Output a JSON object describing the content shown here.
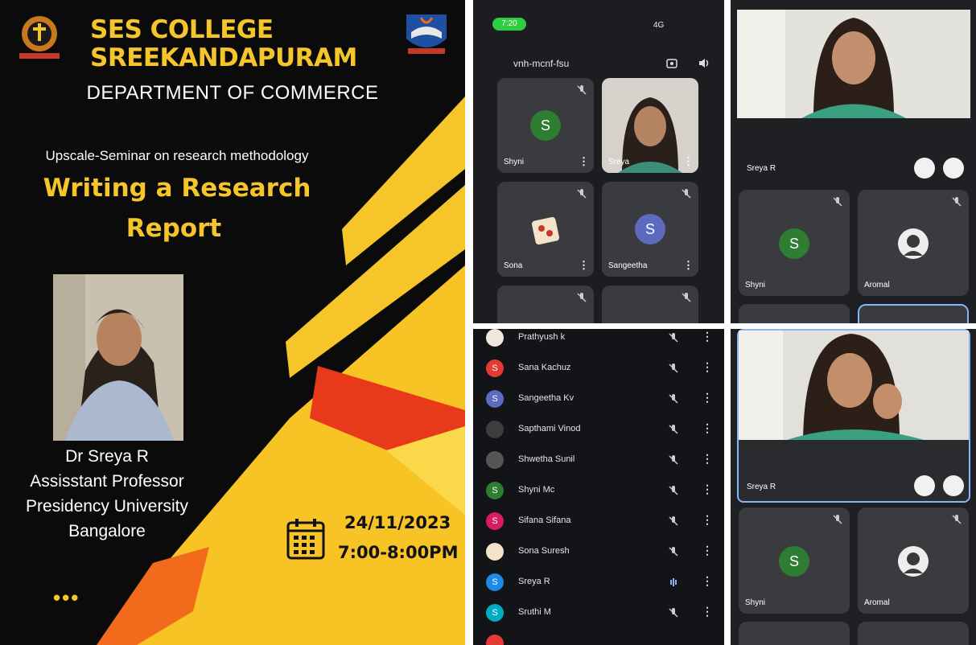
{
  "poster": {
    "college_line1": "SES COLLEGE",
    "college_line2": "SREEKANDAPURAM",
    "department": "DEPARTMENT OF COMMERCE",
    "seminar": "Upscale-Seminar on research methodology",
    "title_line1": "Writing a Research",
    "title_line2": "Report",
    "speaker_name": "Dr Sreya R",
    "speaker_role": "Assisstant Professor",
    "speaker_org": "Presidency University",
    "speaker_city": "Bangalore",
    "date": "24/11/2023",
    "time": "7:00-8:00PM",
    "more_dots": "•••",
    "icons": [
      "college-crest-icon",
      "college-emblem-icon",
      "calendar-icon"
    ],
    "colors": {
      "background": "#0b0b0b",
      "accent_yellow": "#f5c52a",
      "accent_orange": "#f26a1b"
    }
  },
  "phone_grid": {
    "status_time": "7:20",
    "status_network": "4G",
    "meeting_code": "vnh-mcnf-fsu",
    "tiles": [
      {
        "name": "Shyni",
        "initial": "S",
        "color": "#2e7d32"
      },
      {
        "name": "Sreya",
        "initial": "",
        "color": ""
      },
      {
        "name": "Sona",
        "initial": "",
        "color": ""
      },
      {
        "name": "Sangeetha",
        "initial": "S",
        "color": "#5c6bc0"
      }
    ],
    "icons": [
      "camera-switch-icon",
      "speaker-icon",
      "mic-off-icon",
      "more-vert-icon"
    ]
  },
  "speaker_view_top": {
    "main_name": "Sreya R",
    "tiles": [
      {
        "name": "Shyni",
        "initial": "S",
        "color": "#2e7d32"
      },
      {
        "name": "Aromal",
        "initial": "",
        "color": ""
      }
    ]
  },
  "participants": {
    "rows": [
      {
        "name": "Prathyush k",
        "initial": "",
        "color": "#888888"
      },
      {
        "name": "Sana Kachuz",
        "initial": "S",
        "color": "#e53935"
      },
      {
        "name": "Sangeetha Kv",
        "initial": "S",
        "color": "#5c6bc0"
      },
      {
        "name": "Sapthami Vinod",
        "initial": "",
        "color": "#444444"
      },
      {
        "name": "Shwetha Sunil",
        "initial": "",
        "color": "#555555"
      },
      {
        "name": "Shyni Mc",
        "initial": "S",
        "color": "#2e7d32"
      },
      {
        "name": "Sifana Sifana",
        "initial": "S",
        "color": "#d81b60"
      },
      {
        "name": "Sona Suresh",
        "initial": "",
        "color": "#c0392b"
      },
      {
        "name": "Sreya R",
        "initial": "S",
        "color": "#1e88e5"
      },
      {
        "name": "Sruthi M",
        "initial": "S",
        "color": "#00acc1"
      }
    ]
  },
  "speaker_view_bottom": {
    "main_name": "Sreya R",
    "tiles": [
      {
        "name": "Shyni",
        "initial": "S",
        "color": "#2e7d32"
      },
      {
        "name": "Aromal",
        "initial": "",
        "color": ""
      }
    ]
  }
}
